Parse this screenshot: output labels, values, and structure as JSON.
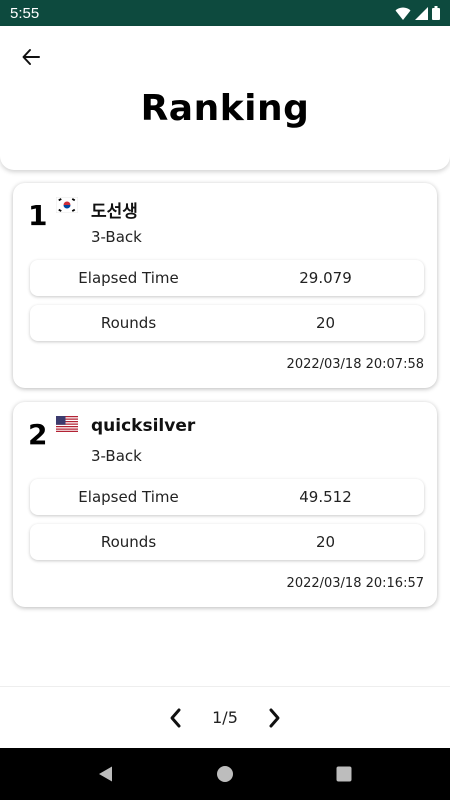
{
  "status_bar": {
    "time": "5:55"
  },
  "header": {
    "title": "Ranking"
  },
  "entries": [
    {
      "rank": "1",
      "country": "south-korea",
      "name": "도선생",
      "mode": "3-Back",
      "elapsed_label": "Elapsed Time",
      "elapsed_value": "29.079",
      "rounds_label": "Rounds",
      "rounds_value": "20",
      "date": "2022/03/18 20:07:58"
    },
    {
      "rank": "2",
      "country": "united-states",
      "name": "quicksilver",
      "mode": "3-Back",
      "elapsed_label": "Elapsed Time",
      "elapsed_value": "49.512",
      "rounds_label": "Rounds",
      "rounds_value": "20",
      "date": "2022/03/18 20:16:57"
    }
  ],
  "pagination": {
    "indicator": "1/5",
    "current_page": 1,
    "total_pages": 5
  },
  "colors": {
    "status_bar": "#0d4a3e",
    "nav_bar": "#000000",
    "text": "#111111"
  },
  "icons": {
    "back": "arrow-left-icon",
    "prev": "chevron-left-icon",
    "next": "chevron-right-icon",
    "nav_back": "triangle-back-icon",
    "nav_home": "circle-home-icon",
    "nav_recents": "square-recents-icon"
  }
}
